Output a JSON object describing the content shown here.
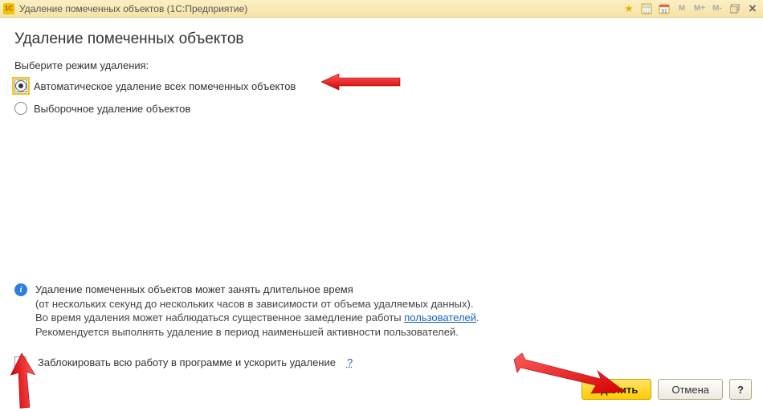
{
  "title": {
    "window": "Удаление помеченных объектов  (1С:Предприятие)",
    "logo_text": "1C"
  },
  "heading": "Удаление помеченных объектов",
  "mode_label": "Выберите режим удаления:",
  "radios": {
    "auto": "Автоматическое удаление всех помеченных объектов",
    "selective": "Выборочное удаление объектов"
  },
  "info": {
    "line1": "Удаление помеченных объектов может занять длительное время",
    "line2_a": "(от нескольких секунд до нескольких часов в зависимости от объема удаляемых данных).",
    "line3_a": "Во время удаления может наблюдаться существенное замедление работы ",
    "line3_link": "пользователей",
    "line3_b": ".",
    "line4": "Рекомендуется выполнять удаление в период наименьшей активности пользователей."
  },
  "block_row": {
    "label": "Заблокировать всю работу в программе и ускорить удаление",
    "help": "?"
  },
  "buttons": {
    "delete": "Удалить",
    "cancel": "Отмена",
    "help": "?"
  },
  "toolbar": {
    "mem": [
      "M",
      "M+",
      "M-"
    ]
  },
  "colors": {
    "accent": "#ffcc00",
    "link": "#1860c3",
    "arrow": "#ff1a1a"
  }
}
